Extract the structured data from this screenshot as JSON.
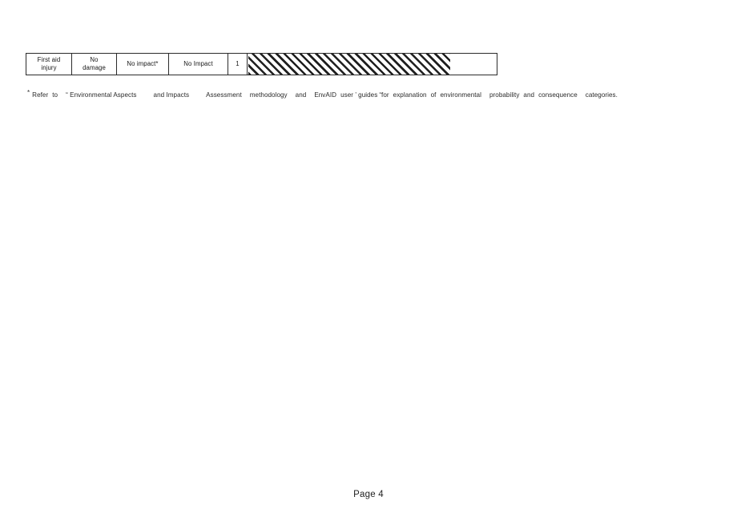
{
  "document": {
    "page_label": "Page 4"
  },
  "matrix": {
    "columns": [
      {
        "name": "injury-severity",
        "lines": [
          "First aid",
          "injury"
        ]
      },
      {
        "name": "damage-severity",
        "lines": [
          "No",
          "damage"
        ]
      },
      {
        "name": "environmental-impact",
        "lines": [
          "No impact*"
        ]
      },
      {
        "name": "community-impact",
        "lines": [
          "No Impact"
        ]
      },
      {
        "name": "consequence-rank",
        "lines": [
          "1"
        ]
      },
      {
        "name": "probability-band",
        "lines": []
      }
    ]
  },
  "footnote": {
    "marker": "*",
    "segments": [
      "Refer",
      "to",
      "“ Environmental Aspects",
      "and  Impacts",
      "Assessment",
      "methodology",
      "and",
      "EnvAID",
      "user ’ guides",
      "“for",
      "explanation",
      "of",
      "environmental",
      "probability",
      "and",
      "consequence",
      "categories."
    ],
    "full_text": "* Refer to “ Environmental Aspects and Impacts Assessment methodology and EnvAID user ’ guides “for explanation of environmental probability and consequence categories."
  },
  "colors": {
    "ink": "#1a1a1a",
    "rule": "#2b2b2b",
    "hatch": "#1f1f1f",
    "paper": "#ffffff"
  }
}
